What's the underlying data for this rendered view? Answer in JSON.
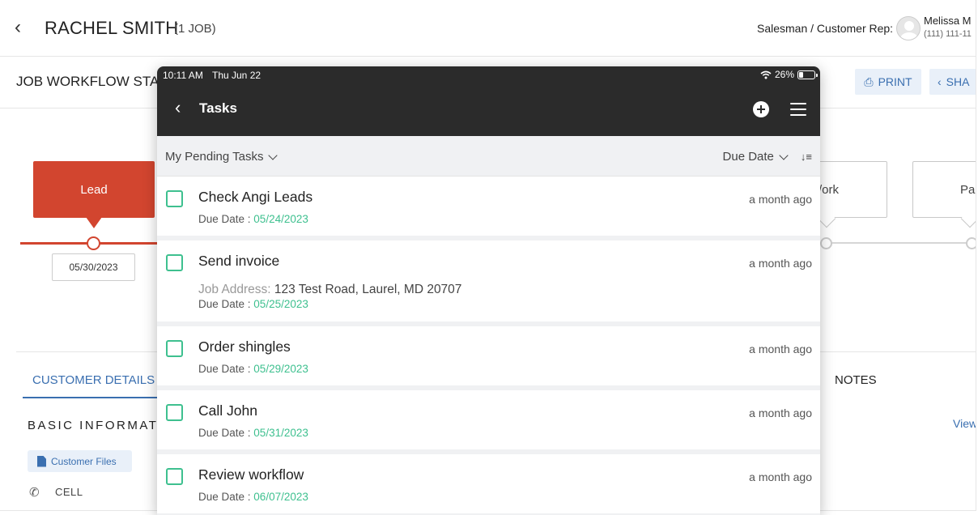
{
  "background": {
    "customer_name": "RACHEL SMITH",
    "job_count": "(1 JOB)",
    "rep_label": "Salesman / Customer Rep:",
    "rep_name": "Melissa M",
    "rep_phone": "(111) 111-11",
    "workflow_title": "JOB WORKFLOW STA",
    "print_label": "PRINT",
    "share_label": "SHA",
    "stages": [
      {
        "label": "Lead",
        "date": "05/30/2023"
      },
      {
        "label": "Work"
      },
      {
        "label": "Pa"
      }
    ],
    "stage_work_visible": "/ork",
    "tab_customer_details": "CUSTOMER DETAILS",
    "tab_notes": "NOTES",
    "basic_info": "BASIC INFORMATI",
    "view_link": "View",
    "customer_files_label": "Customer Files",
    "cell_label": "CELL",
    "accent_color": "#3a6fb0",
    "lead_color": "#d2452f"
  },
  "tablet": {
    "status": {
      "time": "10:11 AM",
      "date": "Thu Jun 22",
      "battery": "26%",
      "battery_level": 0.26
    },
    "nav_title": "Tasks",
    "filter_label": "My Pending Tasks",
    "sort_label": "Due Date",
    "task_accent": "#3ec08f",
    "due_prefix": "Due Date : ",
    "tasks": [
      {
        "title": "Check Angi Leads",
        "time": "a month ago",
        "due": "05/24/2023"
      },
      {
        "title": "Send invoice",
        "time": "a month ago",
        "address_label": "Job Address:",
        "address": "123 Test Road, Laurel, MD 20707",
        "due": "05/25/2023"
      },
      {
        "title": "Order shingles",
        "time": "a month ago",
        "due": "05/29/2023"
      },
      {
        "title": "Call John",
        "time": "a month ago",
        "due": "05/31/2023"
      },
      {
        "title": "Review workflow",
        "time": "a month ago",
        "due": "06/07/2023"
      }
    ]
  }
}
